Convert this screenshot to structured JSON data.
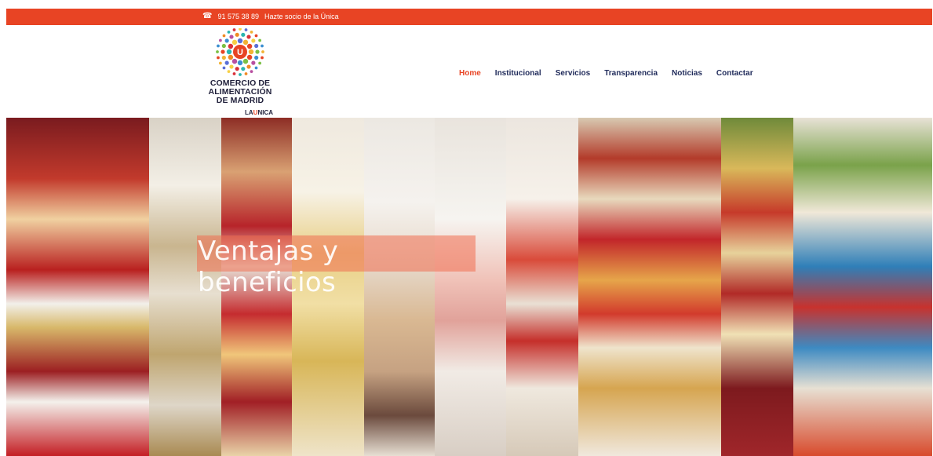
{
  "topbar": {
    "phone": "91 575 38 89",
    "member_link": "Hazte socio de la Única",
    "icon": "phone-icon"
  },
  "logo": {
    "line1": "COMERCIO DE",
    "line2": "ALIMENTACIÓN",
    "line3": "DE MADRID",
    "sub_prefix": "LA",
    "sub_mark": "U",
    "sub_suffix": "NICA"
  },
  "nav": {
    "items": [
      {
        "label": "Home",
        "active": true
      },
      {
        "label": "Institucional"
      },
      {
        "label": "Servicios"
      },
      {
        "label": "Transparencia"
      },
      {
        "label": "Noticias"
      },
      {
        "label": "Contactar"
      }
    ]
  },
  "hero": {
    "title": "Ventajas y beneficios"
  },
  "colors": {
    "accent": "#e84424",
    "nav_text": "#1f2a5a"
  }
}
